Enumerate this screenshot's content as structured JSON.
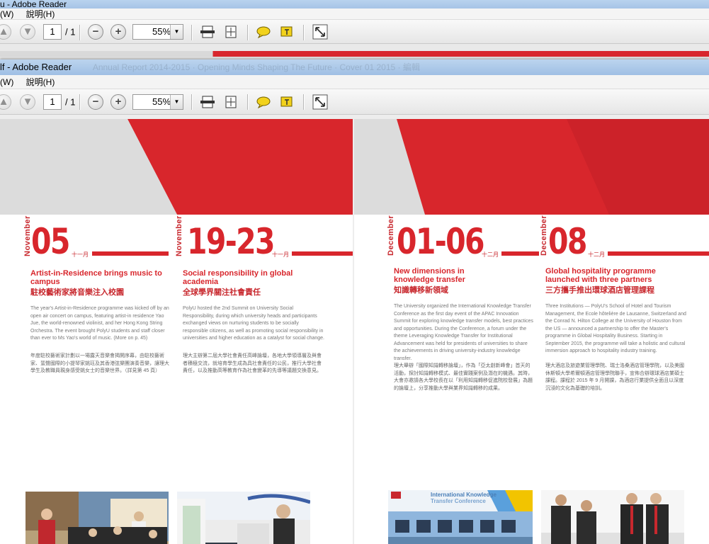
{
  "back_window": {
    "title": "u - Adobe Reader",
    "menu": [
      "(W)",
      "說明(H)"
    ],
    "page_current": "1",
    "page_total": "/ 1",
    "zoom": "55%"
  },
  "front_window": {
    "title": "lf - Adobe Reader",
    "title_ghost": "Annual Report 2014-2015 · Opening Minds Shaping The Future · Cover 01 2015 · 編輯",
    "menu": [
      "(W)",
      "說明(H)"
    ],
    "page_current": "1",
    "page_total": "/ 1",
    "zoom": "55%"
  },
  "icons": [
    "prev-page-icon",
    "next-page-icon",
    "zoom-out-icon",
    "zoom-in-icon",
    "fit-width-icon",
    "fit-page-icon",
    "comment-icon",
    "highlight-icon",
    "fullscreen-icon"
  ],
  "colors": {
    "accent_red": "#d8262c",
    "title_bar": "#a6c4e6"
  },
  "events": [
    {
      "month": "November",
      "date": "05",
      "date_cn": "十一月",
      "title": "Artist-in-Residence brings music to campus",
      "title_cn": "駐校藝術家將音樂注入校園",
      "body": "The year's Artist-in-Residence programme was kicked off by an open air concert on campus, featuring artist-in residence Yao Jue, the world-renowned violinist, and her Hong Kong String Orchestra. The event brought PolyU students and staff closer than ever to Ms Yao's world of music. (More on p. 45)",
      "body_cn": "年度駐校藝術家計劃以一場露天音樂會揭開序幕，由駐校藝術家、蜚聲國際的小提琴家姚珏及其香港弦樂團演奏音樂，讓理大學生及教職員親身感受姚女士的音樂世界。（詳見第 45 頁）"
    },
    {
      "month": "November",
      "date": "19-23",
      "date_cn": "十一月",
      "title": "Social responsibility in global academia",
      "title_cn": "全球學界關注社會責任",
      "body": "PolyU hosted the 2nd Summit on University Social Responsibility, during which university heads and participants exchanged views on nurturing students to be socially responsible citizens, as well as promoting social responsibility in universities and higher education as a catalyst for social change.",
      "body_cn": "理大主辦第二屆大學社會責任高峰論壇，各地大學領導層及與會者積極交流，就培育學生成為具社會責任的公民，推行大學社會責任，以及推動高等教育作為社會變革的先導等議題交換意見。"
    },
    {
      "month": "December",
      "date": "01-06",
      "date_cn": "十二月",
      "title": "New dimensions in knowledge transfer",
      "title_cn": "知識轉移新領域",
      "body": "The University organized the International Knowledge Transfer Conference as the first day event of the APAC Innovation Summit for exploring knowledge transfer models, best practices and opportunities. During the Conference, a forum under the theme Leveraging Knowledge Transfer for Institutional Advancement was held for presidents of universities to share the achievements in driving university-industry knowledge transfer.",
      "body_cn": "理大舉辦「國際知識轉移論壇」，作為「亞太創新峰會」首天的活動，探討知識轉移模式、最佳實踐案例及潛在的機遇。其時，大會亦邀請各大學校長在以「利用知識轉移促進院校發展」為題的論壇上，分享推動大學與業界知識轉移的成果。"
    },
    {
      "month": "December",
      "date": "08",
      "date_cn": "十二月",
      "title": "Global hospitality programme launched with three partners",
      "title_cn": "三方攜手推出環球酒店管理課程",
      "body": "Three Institutions — PolyU's School of Hotel and Tourism Management, the Ecole hôtelière de Lausanne, Switzerland and the Conrad N. Hilton College at the University of Houston from the US — announced a partnership to offer the Master's programme in Global Hospitality Business. Starting in September 2015, the programme will take a holistic and cultural immersion approach to hospitality industry training.",
      "body_cn": "理大酒店及旅遊業管理學院、瑞士洛桑酒店管理學院，以及美國休斯頓大學希爾頓酒店管理學院聯手，宣佈合辦環球酒店業碩士課程。課程於 2015 年 9 月開課，為酒店行業提供全面且以深度沉浸的文化為基礎的培訓。"
    }
  ],
  "photo_banner": {
    "title": "International Knowledge",
    "subtitle": "Transfer Conference"
  }
}
